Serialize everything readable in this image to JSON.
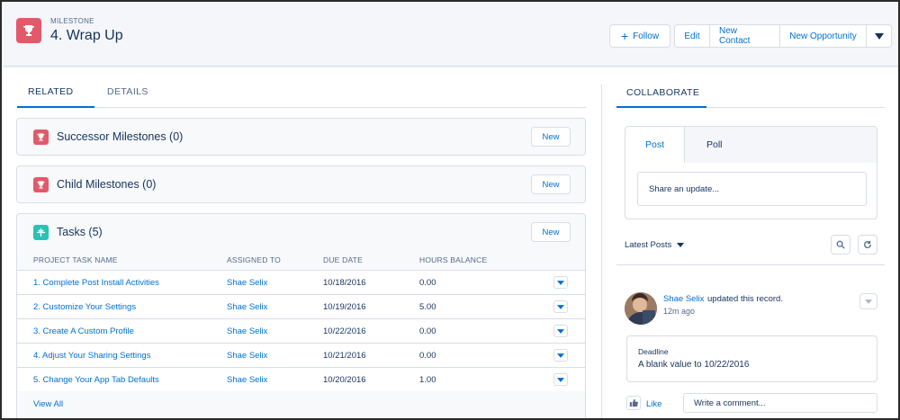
{
  "record": {
    "type_label": "MILESTONE",
    "title": "4. Wrap Up",
    "icon": "trophy-icon",
    "icon_color": "#e25a6a"
  },
  "header_actions": {
    "follow": "Follow",
    "edit": "Edit",
    "new_contact": "New Contact",
    "new_opportunity": "New Opportunity"
  },
  "tabs": {
    "related": "RELATED",
    "details": "DETAILS"
  },
  "related_lists": {
    "successor": {
      "title": "Successor Milestones (0)",
      "new_label": "New"
    },
    "child": {
      "title": "Child Milestones (0)",
      "new_label": "New"
    },
    "tasks": {
      "title": "Tasks (5)",
      "new_label": "New",
      "columns": [
        "PROJECT TASK NAME",
        "ASSIGNED TO",
        "DUE DATE",
        "HOURS BALANCE"
      ],
      "rows": [
        {
          "name": "1. Complete Post Install Activities",
          "assigned": "Shae Selix",
          "due": "10/18/2016",
          "hours": "0.00"
        },
        {
          "name": "2. Customize Your Settings",
          "assigned": "Shae Selix",
          "due": "10/19/2016",
          "hours": "5.00"
        },
        {
          "name": "3. Create A Custom Profile",
          "assigned": "Shae Selix",
          "due": "10/22/2016",
          "hours": "0.00"
        },
        {
          "name": "4. Adjust Your Sharing Settings",
          "assigned": "Shae Selix",
          "due": "10/21/2016",
          "hours": "0.00"
        },
        {
          "name": "5. Change Your App Tab Defaults",
          "assigned": "Shae Selix",
          "due": "10/20/2016",
          "hours": "1.00"
        }
      ],
      "view_all": "View All"
    }
  },
  "collaborate": {
    "tab": "COLLABORATE",
    "publisher": {
      "post_tab": "Post",
      "poll_tab": "Poll",
      "placeholder": "Share an update..."
    },
    "latest_posts": "Latest Posts",
    "post": {
      "author": "Shae Selix",
      "action": "updated this record.",
      "time": "12m ago",
      "field_label": "Deadline",
      "field_change": "A blank value to 10/22/2016",
      "like": "Like",
      "comment_placeholder": "Write a comment..."
    }
  },
  "colors": {
    "accent": "#0070d2",
    "milestone_icon": "#e25a6a",
    "task_icon": "#2ac1b7"
  }
}
